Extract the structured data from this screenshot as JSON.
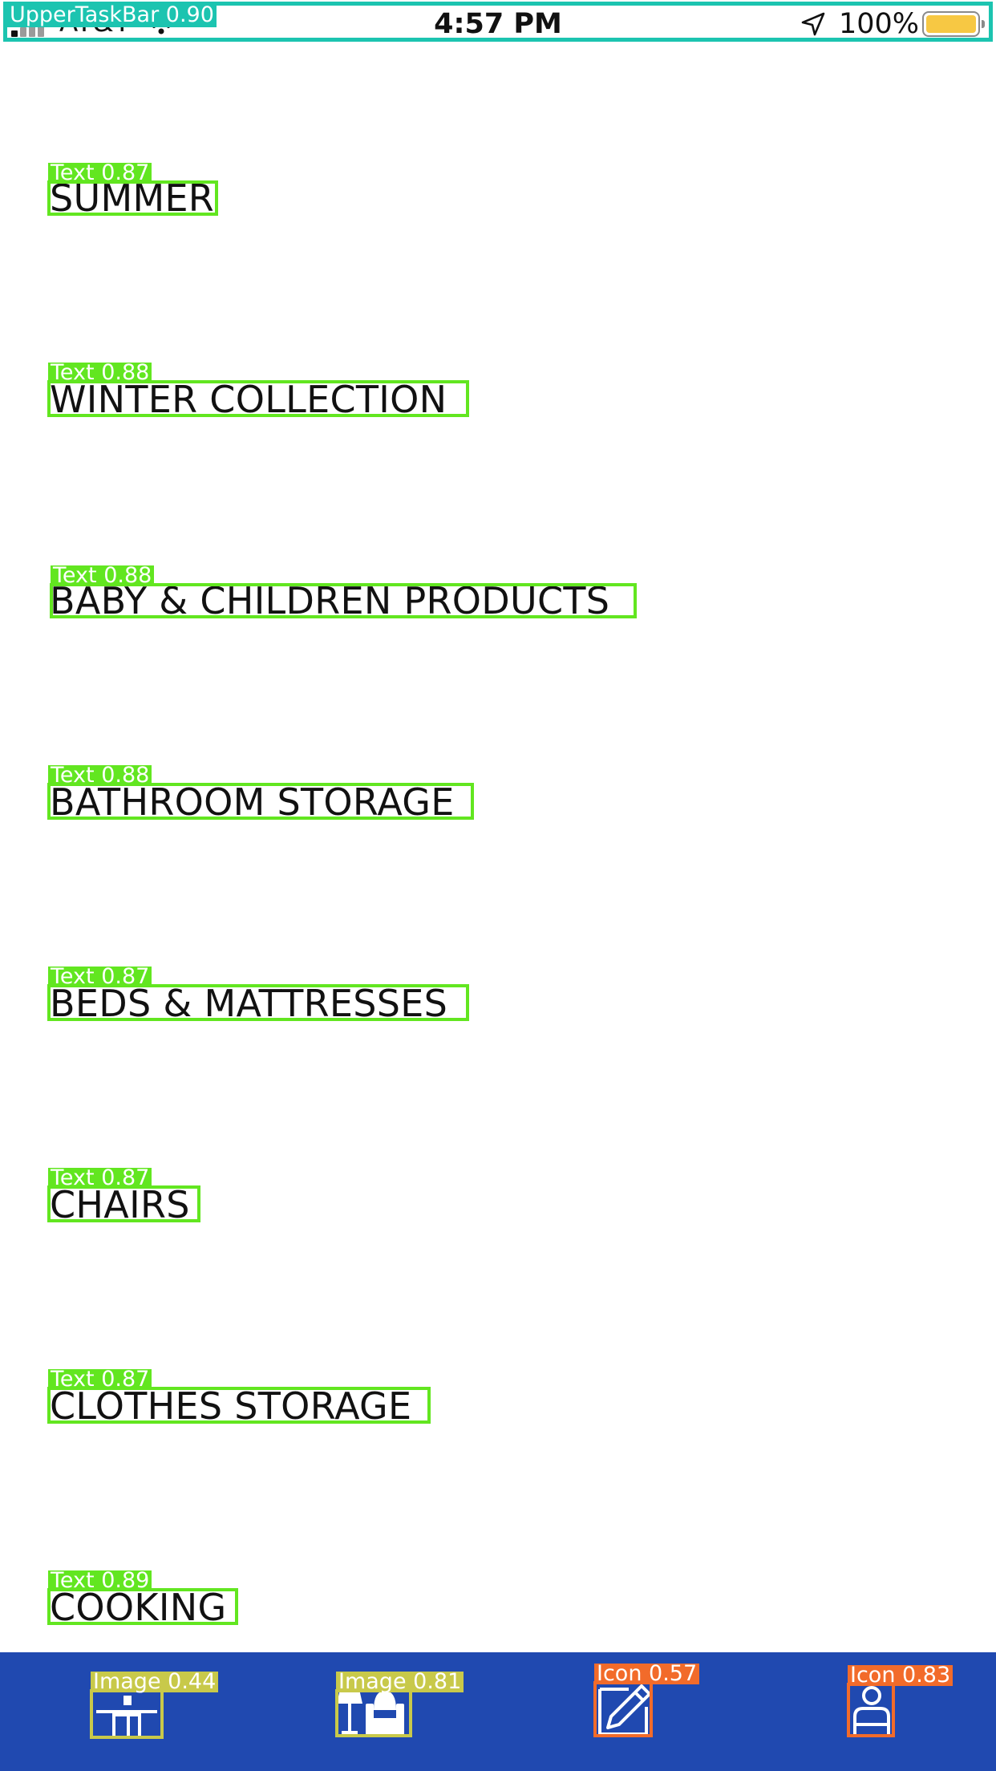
{
  "status_bar": {
    "carrier": "AT&T",
    "time": "4:57 PM",
    "battery_percent": "100%",
    "battery_color": "#f7c843",
    "icons": [
      "signal-icon",
      "wifi-icon",
      "location-arrow-icon",
      "battery-icon"
    ]
  },
  "categories": [
    {
      "label": "SUMMER"
    },
    {
      "label": "WINTER COLLECTION"
    },
    {
      "label": "BABY & CHILDREN PRODUCTS"
    },
    {
      "label": "BATHROOM STORAGE"
    },
    {
      "label": "BEDS & MATTRESSES"
    },
    {
      "label": "CHAIRS"
    },
    {
      "label": "CLOTHES STORAGE"
    },
    {
      "label": "COOKING"
    }
  ],
  "bottom_nav": {
    "background": "#2049b0",
    "items": [
      "store-icon",
      "furniture-icon",
      "edit-icon",
      "profile-icon"
    ]
  },
  "annotations": {
    "upper_task_bar": "UpperTaskBar 0.90",
    "texts": [
      "Text 0.87",
      "Text 0.88",
      "Text 0.88",
      "Text 0.88",
      "Text 0.87",
      "Text 0.87",
      "Text 0.87",
      "Text 0.89"
    ],
    "nav": [
      "Image 0.44",
      "Image 0.81",
      "Icon 0.57",
      "Icon 0.83"
    ]
  }
}
